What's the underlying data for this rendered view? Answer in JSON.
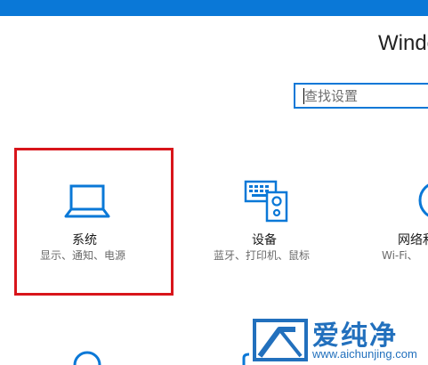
{
  "window": {
    "title": "Windo",
    "accent": "#0a78d7"
  },
  "search": {
    "placeholder": "查找设置",
    "value": ""
  },
  "tiles": [
    {
      "title": "系统",
      "desc": "显示、通知、电源",
      "icon": "laptop-icon"
    },
    {
      "title": "设备",
      "desc": "蓝牙、打印机、鼠标",
      "icon": "keyboard-speaker-icon"
    },
    {
      "title": "网络和",
      "desc": "Wi-Fi、",
      "icon": "globe-icon"
    }
  ],
  "bottom_row_icons": [
    "person-icon",
    "paint-icon"
  ],
  "highlight": {
    "color": "#d8151b"
  },
  "watermark": {
    "text": "爱纯净",
    "url": "www.aichunjing.com",
    "color": "#2270bd"
  }
}
